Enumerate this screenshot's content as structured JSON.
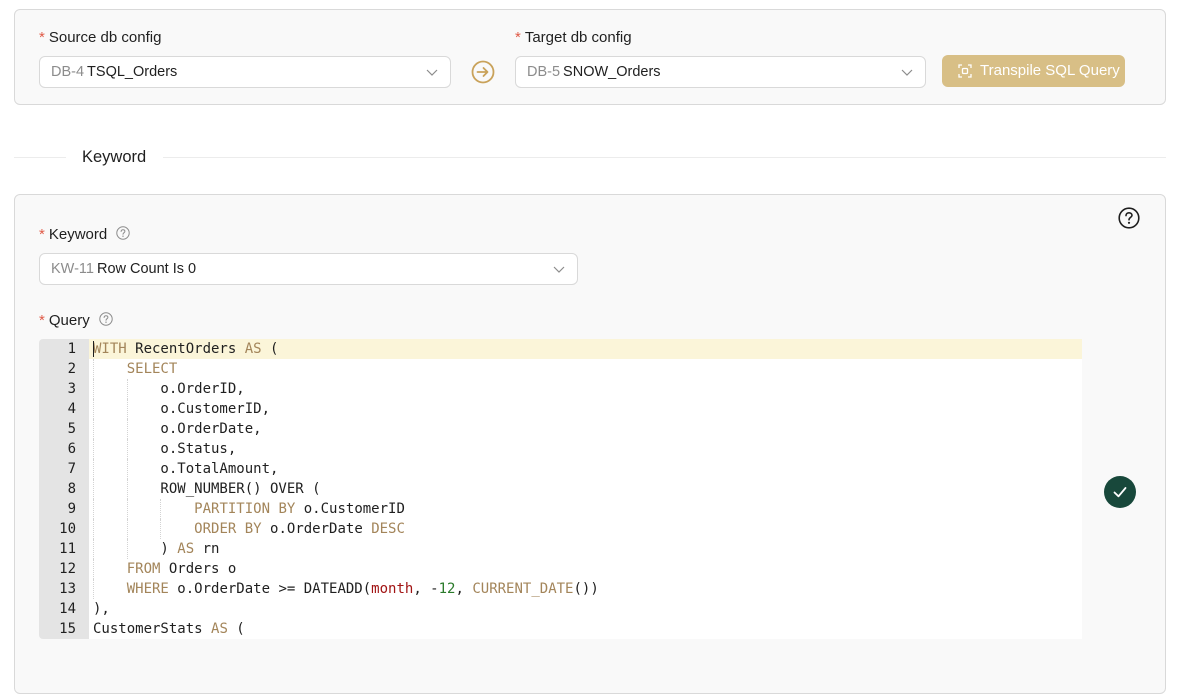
{
  "config": {
    "source": {
      "label": "Source db config",
      "required": "*",
      "code": "DB-4",
      "value": "TSQL_Orders"
    },
    "target": {
      "label": "Target db config",
      "required": "*",
      "code": "DB-5",
      "value": "SNOW_Orders"
    },
    "transpile_label": "Transpile SQL Query"
  },
  "section": {
    "title": "Keyword"
  },
  "keyword": {
    "label": "Keyword",
    "required": "*",
    "code": "KW-11",
    "value": "Row Count Is 0"
  },
  "query": {
    "label": "Query",
    "required": "*",
    "line_numbers": [
      "1",
      "2",
      "3",
      "4",
      "5",
      "6",
      "7",
      "8",
      "9",
      "10",
      "11",
      "12",
      "13",
      "14",
      "15"
    ],
    "lines": [
      "WITH RecentOrders AS (",
      "    SELECT",
      "        o.OrderID,",
      "        o.CustomerID,",
      "        o.OrderDate,",
      "        o.Status,",
      "        o.TotalAmount,",
      "        ROW_NUMBER() OVER (",
      "            PARTITION BY o.CustomerID",
      "            ORDER BY o.OrderDate DESC",
      "        ) AS rn",
      "    FROM Orders o",
      "    WHERE o.OrderDate >= DATEADD(month, -12, CURRENT_DATE())",
      "),",
      "CustomerStats AS ("
    ],
    "valid": true
  },
  "icons": {
    "chevron": "chevron-down-icon",
    "arrow": "arrow-right-circle-icon",
    "transpile": "transpile-icon",
    "help": "question-circle-icon",
    "check": "check-icon"
  },
  "colors": {
    "accent": "#d8bf86",
    "arrow": "#c9a25a",
    "success": "#18483b",
    "required": "#e05a47",
    "keyword": "#a3855a"
  }
}
